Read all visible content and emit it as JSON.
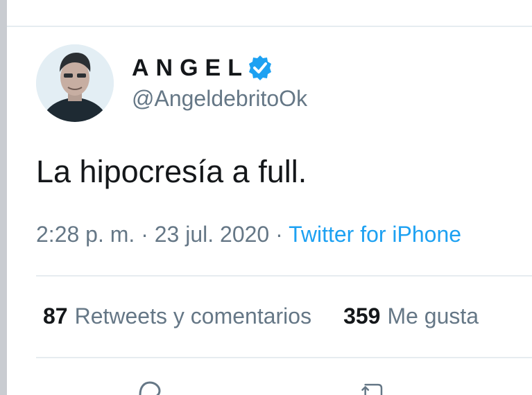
{
  "tweet": {
    "author": {
      "display_name": "ANGEL",
      "handle": "@AngeldebritoOk",
      "verified": true,
      "avatar_icon": "avatar-photo"
    },
    "text": "La hipocresía a full.",
    "meta": {
      "time": "2:28 p. m.",
      "separator": "·",
      "date": "23 jul. 2020",
      "source": "Twitter for iPhone"
    },
    "stats": {
      "retweets_count": "87",
      "retweets_label": "Retweets y comentarios",
      "likes_count": "359",
      "likes_label": "Me gusta"
    },
    "actions": {
      "reply_icon": "reply-icon",
      "retweet_icon": "retweet-icon"
    }
  },
  "colors": {
    "primary_text": "#14171a",
    "secondary_text": "#657786",
    "link": "#1da1f2",
    "divider": "#e6ecf0"
  }
}
